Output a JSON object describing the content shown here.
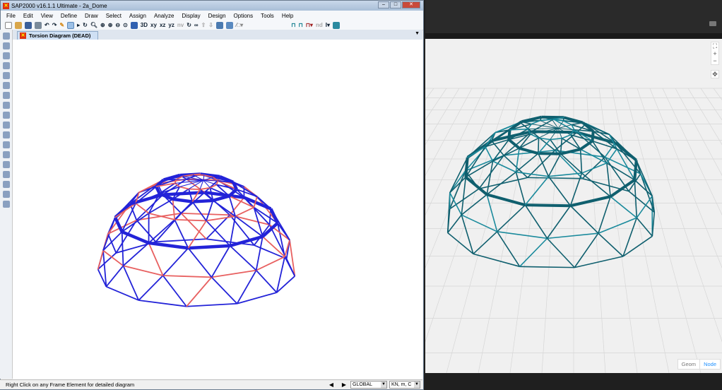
{
  "window": {
    "title": "SAP2000 v16.1.1 Ultimate  - 2a_Dome"
  },
  "menu": [
    "File",
    "Edit",
    "View",
    "Define",
    "Draw",
    "Select",
    "Assign",
    "Analyze",
    "Display",
    "Design",
    "Options",
    "Tools",
    "Help"
  ],
  "toolbar": {
    "xy": "xy",
    "xz": "xz",
    "yz": "yz",
    "nv": "nv",
    "nd": "nd"
  },
  "tab": {
    "label": "Torsion Diagram   (DEAD)"
  },
  "status": {
    "text": "Right Click on any Frame Element for detailed diagram",
    "coord_system": "GLOBAL",
    "units": "KN, m, C"
  },
  "viewer": {
    "modes": [
      "Geom",
      "Node"
    ],
    "active_mode": "Node",
    "zoom_in": "+",
    "zoom_out": "−"
  },
  "colors": {
    "frame_blue": "#2323d8",
    "frame_red": "#e86060",
    "viewer_teal": "#1a8a9c",
    "active_mode": "#1e90ff"
  }
}
